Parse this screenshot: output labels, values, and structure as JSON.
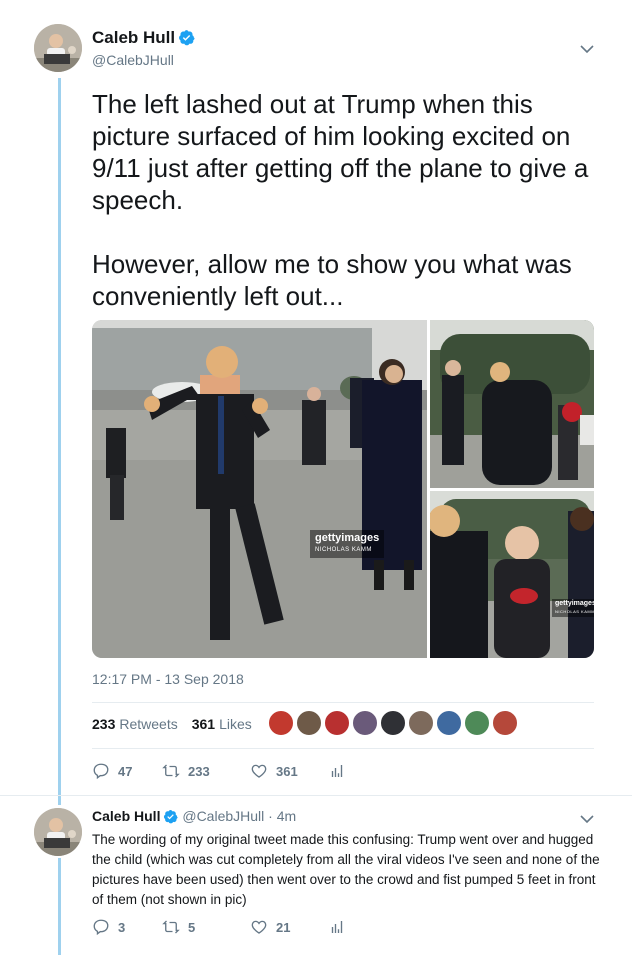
{
  "main_tweet": {
    "display_name": "Caleb Hull",
    "handle": "@CalebJHull",
    "paragraphs": [
      "The left lashed out at Trump when this picture surfaced of him looking excited on 9/11 just after getting off the plane to give a speech.",
      "However, allow me to show you what was conveniently left out..."
    ],
    "media": {
      "watermark_brand": "gettyimages",
      "watermark_credit_main": "NICHOLAS KAMM",
      "watermark_credit_small": "NICHOLAS KAMM"
    },
    "timestamp": "12:17 PM - 13 Sep 2018",
    "stats": {
      "retweets_count": "233",
      "retweets_label": "Retweets",
      "likes_count": "361",
      "likes_label": "Likes"
    },
    "actions": {
      "replies": "47",
      "retweets": "233",
      "likes": "361"
    }
  },
  "reply_tweet": {
    "display_name": "Caleb Hull",
    "handle": "@CalebJHull",
    "time": "· 4m",
    "text": "The wording of my original tweet made this confusing: Trump went over and hugged the child (which was cut completely from all the viral videos I've seen and none of the pictures have been used) then went over to the crowd and fist pumped 5 feet in front of them (not shown in pic)",
    "actions": {
      "replies": "3",
      "retweets": "5",
      "likes": "21"
    }
  },
  "colors": {
    "verified": "#1da1f2",
    "thread_line": "#9fd1ee",
    "muted_text": "#657786"
  }
}
